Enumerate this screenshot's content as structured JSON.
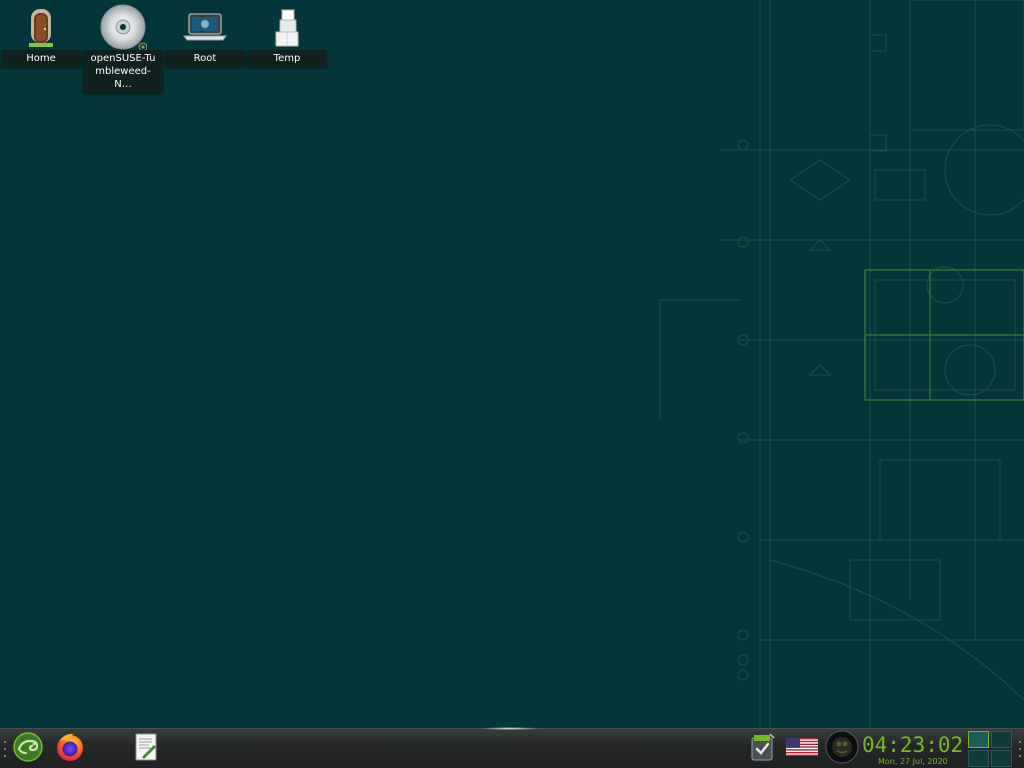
{
  "desktop": {
    "background_color": "#02363a",
    "icons": [
      {
        "label": "Home",
        "icon": "home-door-icon"
      },
      {
        "label": "openSUSE-Tumbleweed-N…",
        "icon": "optical-disc-icon"
      },
      {
        "label": "Root",
        "icon": "laptop-root-icon"
      },
      {
        "label": "Temp",
        "icon": "temp-boxes-icon"
      }
    ]
  },
  "panel": {
    "launchers": [
      {
        "name": "openSUSE application menu",
        "icon": "opensuse-gecko-icon"
      },
      {
        "name": "Firefox",
        "icon": "firefox-icon"
      },
      {
        "name": "Text editor",
        "icon": "text-editor-icon"
      }
    ],
    "tray": [
      {
        "name": "updates",
        "icon": "update-checkmark-icon"
      },
      {
        "name": "keyboard layout",
        "icon": "us-flag-icon"
      },
      {
        "name": "network",
        "icon": "network-globe-icon"
      }
    ],
    "clock": {
      "time": "04:23:02",
      "date": "Mon, 27 Jul, 2020",
      "color": "#73ba25"
    },
    "pager": {
      "active_desktop": 1
    }
  }
}
